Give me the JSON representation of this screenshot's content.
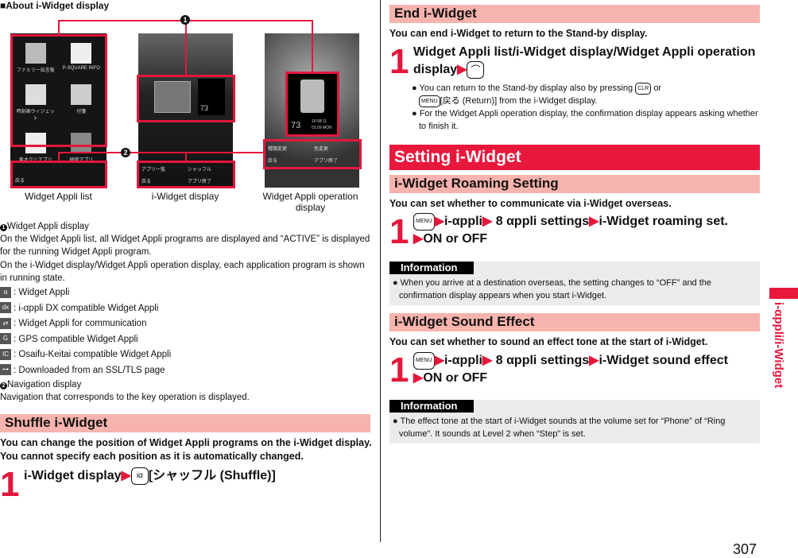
{
  "left": {
    "title": "■About i-Widget display",
    "callouts": [
      "1",
      "2"
    ],
    "captions": [
      "Widget Appli list",
      "i-Widget display",
      "Widget Appli operation display"
    ],
    "screens": {
      "list_apps": [
        "ファミリー伝言板",
        "P-SQUARE INFO",
        "時刻表ウィジェット",
        "付箋",
        "楽オク☆アプリ",
        "地図アプリ"
      ],
      "list_nav": [
        "戻る"
      ],
      "widget_text": "73",
      "widget_nav": [
        "アプリ一覧",
        "シャッフル",
        "戻る",
        "アプリ終了"
      ],
      "op_time": "16:58:11",
      "op_date": "03.09 MON",
      "op_value": "73",
      "op_nav": [
        "種類変更",
        "色変更",
        "戻る",
        "アプリ終了"
      ]
    },
    "desc1_title": "Widget Appli display",
    "desc1_p1": "On the Widget Appli list, all Widget Appli programs are displayed and “ACTIVE” is displayed for the running Widget Appli program.",
    "desc1_p2": "On the i-Widget display/Widget Appli operation display, each application program is shown in running state.",
    "legend": [
      {
        "icon": "α",
        "text": ": Widget Appli"
      },
      {
        "icon": "dx",
        "text": ": i-αppli DX compatible Widget Appli"
      },
      {
        "icon": "⇄",
        "text": ": Widget Appli for communication"
      },
      {
        "icon": "G",
        "text": ": GPS compatible Widget Appli"
      },
      {
        "icon": "IC",
        "text": ": Osaifu-Keitai compatible Widget Appli"
      },
      {
        "icon": "⊶",
        "text": ": Downloaded from an SSL/TLS page"
      }
    ],
    "desc2_title": "Navigation display",
    "desc2_p": "Navigation that corresponds to the key operation is displayed.",
    "shuffle": {
      "header": "Shuffle i-Widget",
      "intro": "You can change the position of Widget Appli programs on the i-Widget display. You cannot specify each position as it is automatically changed.",
      "step_num": "1",
      "step_pre": "i-Widget display",
      "step_key": "iα",
      "step_post": "[シャッフル (Shuffle)]"
    }
  },
  "right": {
    "end": {
      "header": "End i-Widget",
      "intro": "You can end i-Widget to return to the Stand-by display.",
      "step_num": "1",
      "step_text": "Widget Appli list/i-Widget display/Widget Appli operation display",
      "step_key": "⌒",
      "b1_a": "You can return to the Stand-by display also by pressing",
      "b1_key1": "CLR",
      "b1_or": "or",
      "b1_key2": "MENU",
      "b1_b": "[戻る (Return)] from the i-Widget display.",
      "b2": "For the Widget Appli operation display, the confirmation display appears asking whether to finish it."
    },
    "setting_header": "Setting i-Widget",
    "roaming": {
      "header": "i-Widget Roaming Setting",
      "intro": "You can set whether to communicate via i-Widget overseas.",
      "step_num": "1",
      "key": "MENU",
      "s1": "i-αppli",
      "s2": "8 αppli settings",
      "s3": "i-Widget roaming set.",
      "s4": "ON or OFF",
      "info_label": "Information",
      "info": "When you arrive at a destination overseas, the setting changes to “OFF” and the confirmation display appears when you start i-Widget."
    },
    "sound": {
      "header": "i-Widget Sound Effect",
      "intro": "You can set whether to sound an effect tone at the start of i-Widget.",
      "step_num": "1",
      "key": "MENU",
      "s1": "i-αppli",
      "s2": "8 αppli settings",
      "s3": "i-Widget sound effect",
      "s4": "ON or OFF",
      "info_label": "Information",
      "info": "The effect tone at the start of i-Widget sounds at the volume set for “Phone” of “Ring volume”. It sounds at Level 2 when “Step” is set."
    }
  },
  "side_tab": "i-αppli/i-Widget",
  "page_number": "307",
  "colors": {
    "accent": "#e3173c",
    "section_bg": "#f7b3ad",
    "info_bg": "#ebebeb"
  }
}
